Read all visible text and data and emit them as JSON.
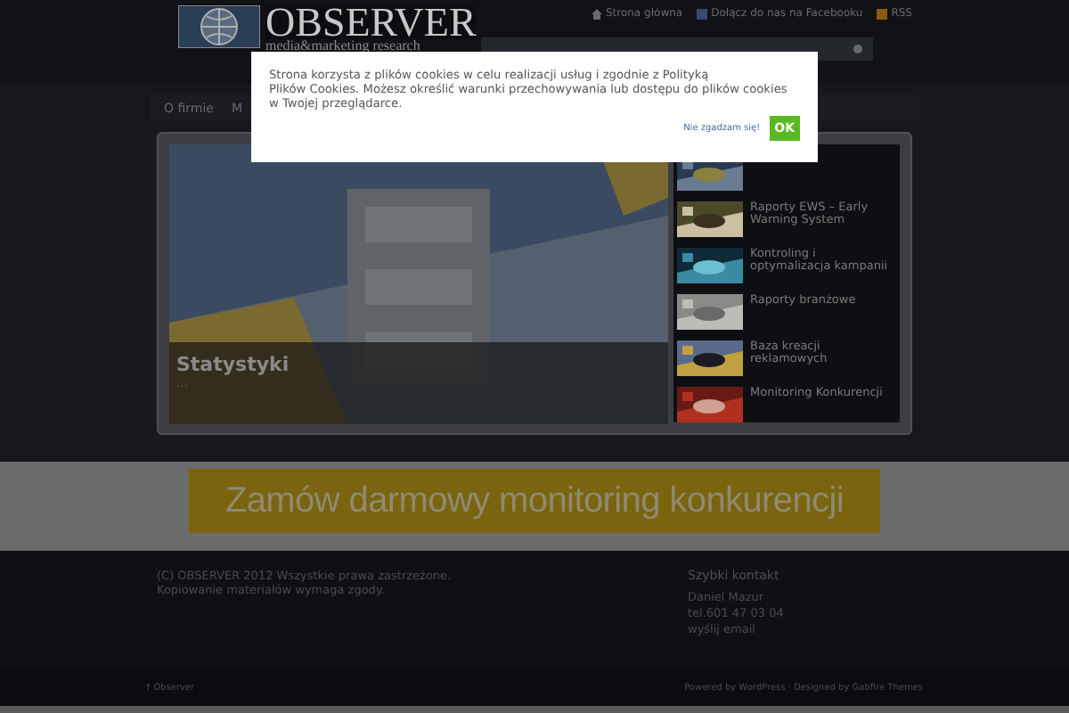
{
  "top_links": [
    {
      "kind": "home",
      "label": "Strona główna"
    },
    {
      "kind": "facebook",
      "label": "Dołącz do nas na Facebooku"
    },
    {
      "kind": "rss",
      "label": "RSS"
    }
  ],
  "logo": {
    "name": "OBSERVER",
    "tagline": "media&marketing research"
  },
  "nav": [
    {
      "label": "O firmie"
    },
    {
      "label": "M"
    }
  ],
  "slider": {
    "caption": "Statystyki",
    "caption_more": "...",
    "items": [
      {
        "title": "Raporty EWS – Early Warning System"
      },
      {
        "title": "Kontroling i optymalizacja kampanii"
      },
      {
        "title": "Raporty branżowe"
      },
      {
        "title": "Baza kreacji reklamowych"
      },
      {
        "title": "Monitoring Konkurencji"
      }
    ]
  },
  "banner": {
    "text": "Zamów darmowy monitoring konkurencji"
  },
  "footer": {
    "copyright": [
      "(C) OBSERVER 2012 Wszystkie prawa zastrzeżone.",
      "Kopiowanie materiałów wymaga zgody."
    ],
    "contact_title": "Szybki kontakt",
    "contact": [
      "Daniel Mazur",
      "tel.601 47 03 04",
      "wyślij email"
    ],
    "bottom_left": "† Observer",
    "bottom_right": "Powered by WordPress · Designed by Gabfire Themes"
  },
  "cookie_popup": {
    "lines": [
      "Strona korzysta z plików cookies w celu realizacji usług i zgodnie z Polityką",
      "Plików Cookies. Możesz określić warunki przechowywania lub dostępu do plików cookies",
      "w Twojej przeglądarce."
    ],
    "decline": "Nie zgadzam się!",
    "accept": "OK"
  }
}
